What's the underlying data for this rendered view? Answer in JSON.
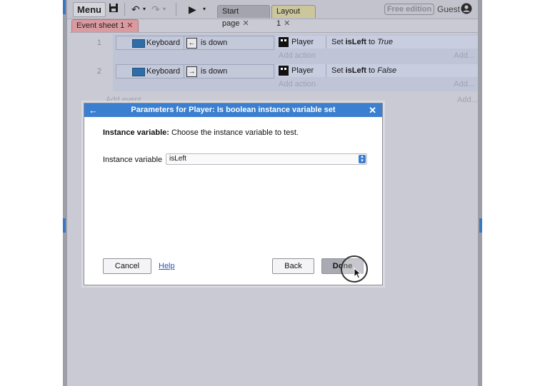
{
  "toolbar": {
    "menu_label": "Menu",
    "tabs": [
      {
        "label": "Start page"
      },
      {
        "label": "Layout 1"
      }
    ],
    "free_badge": "Free edition",
    "user_label": "Guest"
  },
  "sheet_tab": {
    "label": "Event sheet 1"
  },
  "events": [
    {
      "number": "1",
      "condition_object": "Keyboard",
      "condition_text": "is down",
      "key_glyph": "←",
      "action_object": "Player",
      "action_prefix": "Set",
      "action_var": "isLeft",
      "action_mid": "to",
      "action_value": "True",
      "add_action": "Add action",
      "add_dots": "Add..."
    },
    {
      "number": "2",
      "condition_object": "Keyboard",
      "condition_text": "is down",
      "key_glyph": "→",
      "action_object": "Player",
      "action_prefix": "Set",
      "action_var": "isLeft",
      "action_mid": "to",
      "action_value": "False",
      "add_action": "Add action",
      "add_dots": "Add..."
    }
  ],
  "add_event": "Add event",
  "add_event_dots": "Add...",
  "dialog": {
    "title": "Parameters for Player: Is boolean instance variable set",
    "desc_bold": "Instance variable:",
    "desc_text": " Choose the instance variable to test.",
    "field_label": "Instance variable",
    "field_value": "isLeft",
    "cancel_label": "Cancel",
    "help_label": "Help",
    "back_label": "Back",
    "done_label": "Done"
  },
  "colors": {
    "dialog_title": "#3a7fd0",
    "sheet_tab": "#d99aa0",
    "layout_tab": "#cbc69c"
  }
}
